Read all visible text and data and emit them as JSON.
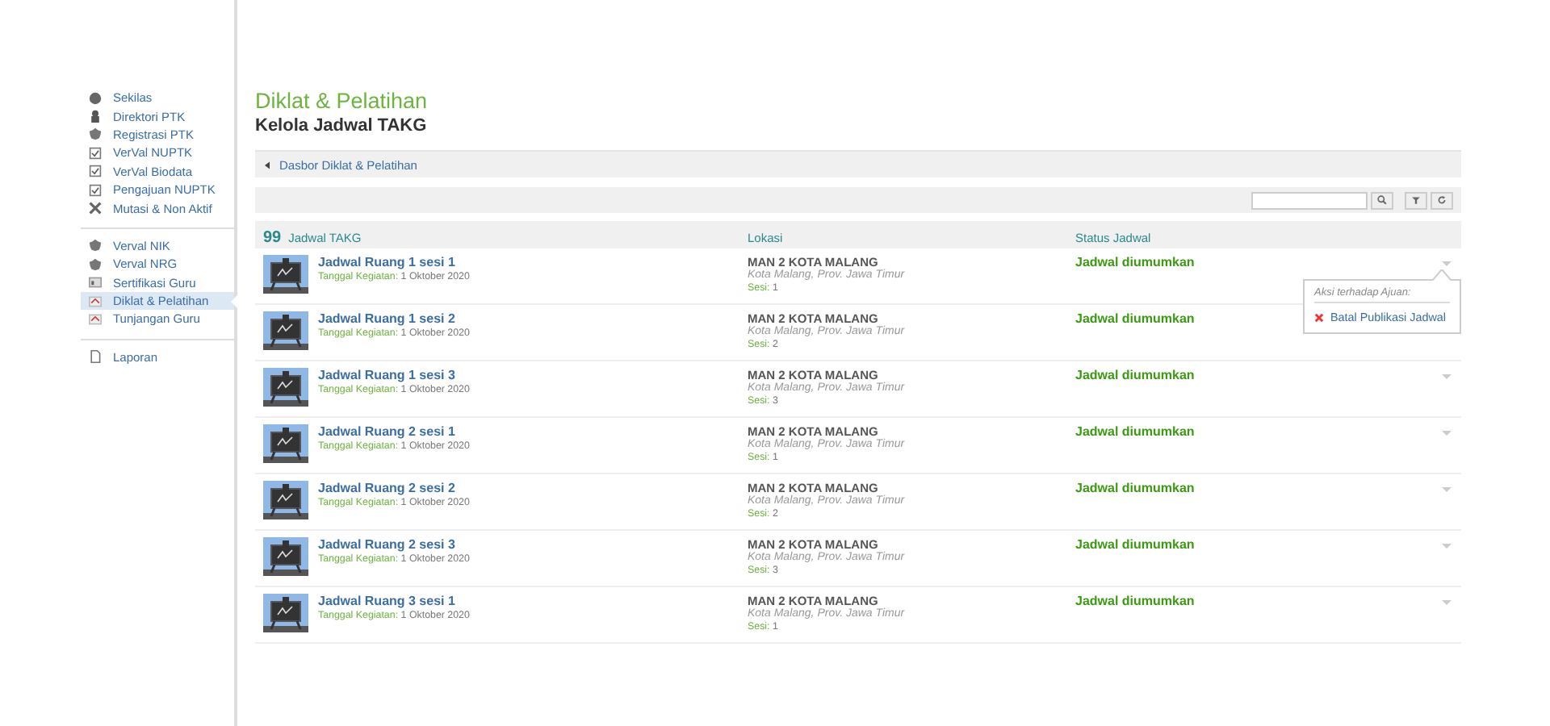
{
  "sidebar": {
    "groups": [
      [
        {
          "label": "Sekilas",
          "selected": false
        },
        {
          "label": "Direktori PTK",
          "selected": false
        },
        {
          "label": "Registrasi PTK",
          "selected": false
        },
        {
          "label": "VerVal NUPTK",
          "selected": false
        },
        {
          "label": "VerVal Biodata",
          "selected": false
        },
        {
          "label": "Pengajuan NUPTK",
          "selected": false
        },
        {
          "label": "Mutasi & Non Aktif",
          "selected": false
        }
      ],
      [
        {
          "label": "Verval NIK",
          "selected": false
        },
        {
          "label": "Verval NRG",
          "selected": false
        },
        {
          "label": "Sertifikasi Guru",
          "selected": false
        },
        {
          "label": "Diklat & Pelatihan",
          "selected": true
        },
        {
          "label": "Tunjangan Guru",
          "selected": false
        }
      ],
      [
        {
          "label": "Laporan",
          "selected": false
        }
      ]
    ]
  },
  "page_title": "Diklat & Pelatihan",
  "page_subtitle": "Kelola Jadwal TAKG",
  "breadcrumb": "Dasbor Diklat & Pelatihan",
  "table": {
    "count": "99",
    "count_label": "Jadwal TAKG",
    "columns": [
      "Lokasi",
      "Status Jadwal"
    ],
    "rows": [
      {
        "title": "Jadwal Ruang 1 sesi 1",
        "date_label": "Tanggal Kegiatan:",
        "date": "1 Oktober 2020",
        "school": "MAN 2 KOTA MALANG",
        "place": "Kota Malang, Prov. Jawa Timur",
        "session_label": "Sesi:",
        "session": "1",
        "status": "Jadwal diumumkan",
        "caret": true
      },
      {
        "title": "Jadwal Ruang 1 sesi 2",
        "date_label": "Tanggal Kegiatan:",
        "date": "1 Oktober 2020",
        "school": "MAN 2 KOTA MALANG",
        "place": "Kota Malang, Prov. Jawa Timur",
        "session_label": "Sesi:",
        "session": "2",
        "status": "Jadwal diumumkan",
        "caret": false
      },
      {
        "title": "Jadwal Ruang 1 sesi 3",
        "date_label": "Tanggal Kegiatan:",
        "date": "1 Oktober 2020",
        "school": "MAN 2 KOTA MALANG",
        "place": "Kota Malang, Prov. Jawa Timur",
        "session_label": "Sesi:",
        "session": "3",
        "status": "Jadwal diumumkan",
        "caret": true
      },
      {
        "title": "Jadwal Ruang 2 sesi 1",
        "date_label": "Tanggal Kegiatan:",
        "date": "1 Oktober 2020",
        "school": "MAN 2 KOTA MALANG",
        "place": "Kota Malang, Prov. Jawa Timur",
        "session_label": "Sesi:",
        "session": "1",
        "status": "Jadwal diumumkan",
        "caret": true
      },
      {
        "title": "Jadwal Ruang 2 sesi 2",
        "date_label": "Tanggal Kegiatan:",
        "date": "1 Oktober 2020",
        "school": "MAN 2 KOTA MALANG",
        "place": "Kota Malang, Prov. Jawa Timur",
        "session_label": "Sesi:",
        "session": "2",
        "status": "Jadwal diumumkan",
        "caret": true
      },
      {
        "title": "Jadwal Ruang 2 sesi 3",
        "date_label": "Tanggal Kegiatan:",
        "date": "1 Oktober 2020",
        "school": "MAN 2 KOTA MALANG",
        "place": "Kota Malang, Prov. Jawa Timur",
        "session_label": "Sesi:",
        "session": "3",
        "status": "Jadwal diumumkan",
        "caret": true
      },
      {
        "title": "Jadwal Ruang 3 sesi 1",
        "date_label": "Tanggal Kegiatan:",
        "date": "1 Oktober 2020",
        "school": "MAN 2 KOTA MALANG",
        "place": "Kota Malang, Prov. Jawa Timur",
        "session_label": "Sesi:",
        "session": "1",
        "status": "Jadwal diumumkan",
        "caret": true
      }
    ]
  },
  "action_menu": {
    "heading": "Aksi terhadap Ajuan:",
    "items": [
      "Batal Publikasi Jadwal"
    ]
  }
}
